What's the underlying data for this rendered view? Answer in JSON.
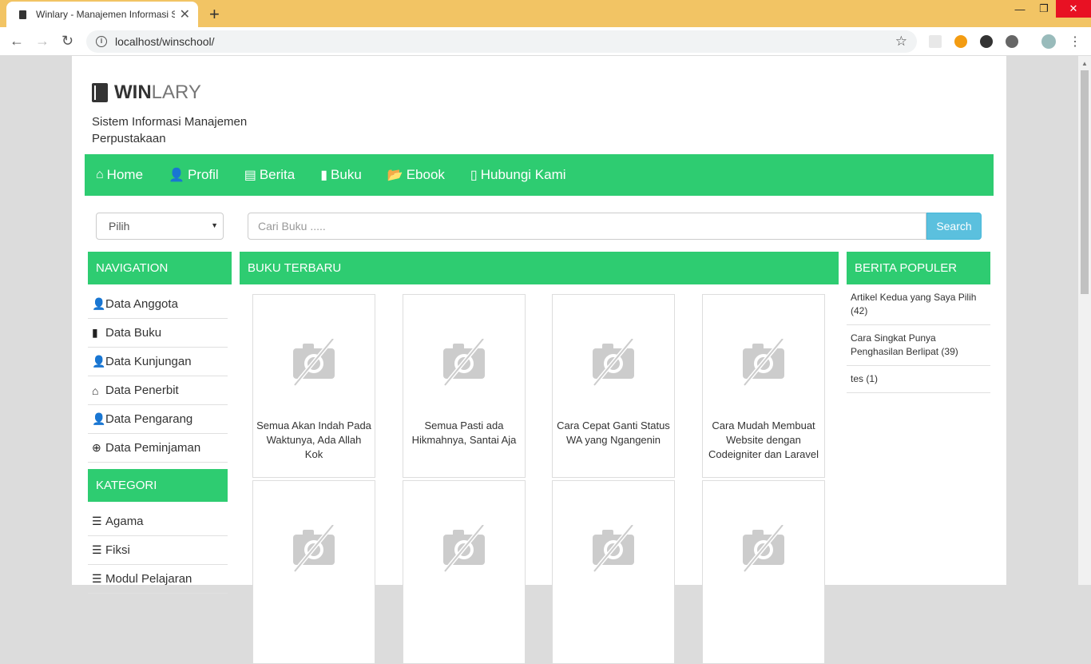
{
  "browser": {
    "tab_title": "Winlary - Manajemen Informasi S",
    "tab_close": "✕",
    "new_tab": "+",
    "url": "localhost/winschool/"
  },
  "site": {
    "brand_bold": "WIN",
    "brand_light": "LARY",
    "tagline": "Sistem Informasi Manajemen Perpustakaan"
  },
  "menu": [
    {
      "label": "Home",
      "icon": "home-icon"
    },
    {
      "label": "Profil",
      "icon": "user-icon"
    },
    {
      "label": "Berita",
      "icon": "newspaper-icon"
    },
    {
      "label": "Buku",
      "icon": "book-icon"
    },
    {
      "label": "Ebook",
      "icon": "folder-open-icon"
    },
    {
      "label": "Hubungi Kami",
      "icon": "phone-icon"
    }
  ],
  "search": {
    "select_value": "Pilih",
    "placeholder": "Cari Buku .....",
    "button": "Search"
  },
  "navigation": {
    "title": "NAVIGATION",
    "items": [
      {
        "label": "Data Anggota",
        "icon": "user-icon"
      },
      {
        "label": "Data Buku",
        "icon": "book-icon"
      },
      {
        "label": "Data Kunjungan",
        "icon": "user-icon"
      },
      {
        "label": "Data Penerbit",
        "icon": "home-icon"
      },
      {
        "label": "Data Pengarang",
        "icon": "user-icon"
      },
      {
        "label": "Data Peminjaman",
        "icon": "download-circle-icon"
      }
    ]
  },
  "kategori": {
    "title": "KATEGORI",
    "items": [
      {
        "label": "Agama",
        "icon": "list-icon"
      },
      {
        "label": "Fiksi",
        "icon": "list-icon"
      },
      {
        "label": "Modul Pelajaran",
        "icon": "list-icon"
      }
    ]
  },
  "buku_terbaru": {
    "title": "BUKU TERBARU",
    "books": [
      {
        "title": "Semua Akan Indah Pada Waktunya, Ada Allah Kok"
      },
      {
        "title": "Semua Pasti ada Hikmahnya, Santai Aja"
      },
      {
        "title": "Cara Cepat Ganti Status WA yang Ngangenin"
      },
      {
        "title": "Cara Mudah Membuat Website dengan Codeigniter dan Laravel"
      },
      {
        "title": ""
      },
      {
        "title": ""
      },
      {
        "title": ""
      },
      {
        "title": ""
      }
    ]
  },
  "berita_populer": {
    "title": "BERITA POPULER",
    "items": [
      {
        "label": "Artikel Kedua yang Saya Pilih (42)"
      },
      {
        "label": "Cara Singkat Punya Penghasilan Berlipat (39)"
      },
      {
        "label": "tes (1)"
      }
    ]
  },
  "colors": {
    "accent": "#2ecc71",
    "search_button": "#5bc0de",
    "tabbar": "#f2c464"
  }
}
